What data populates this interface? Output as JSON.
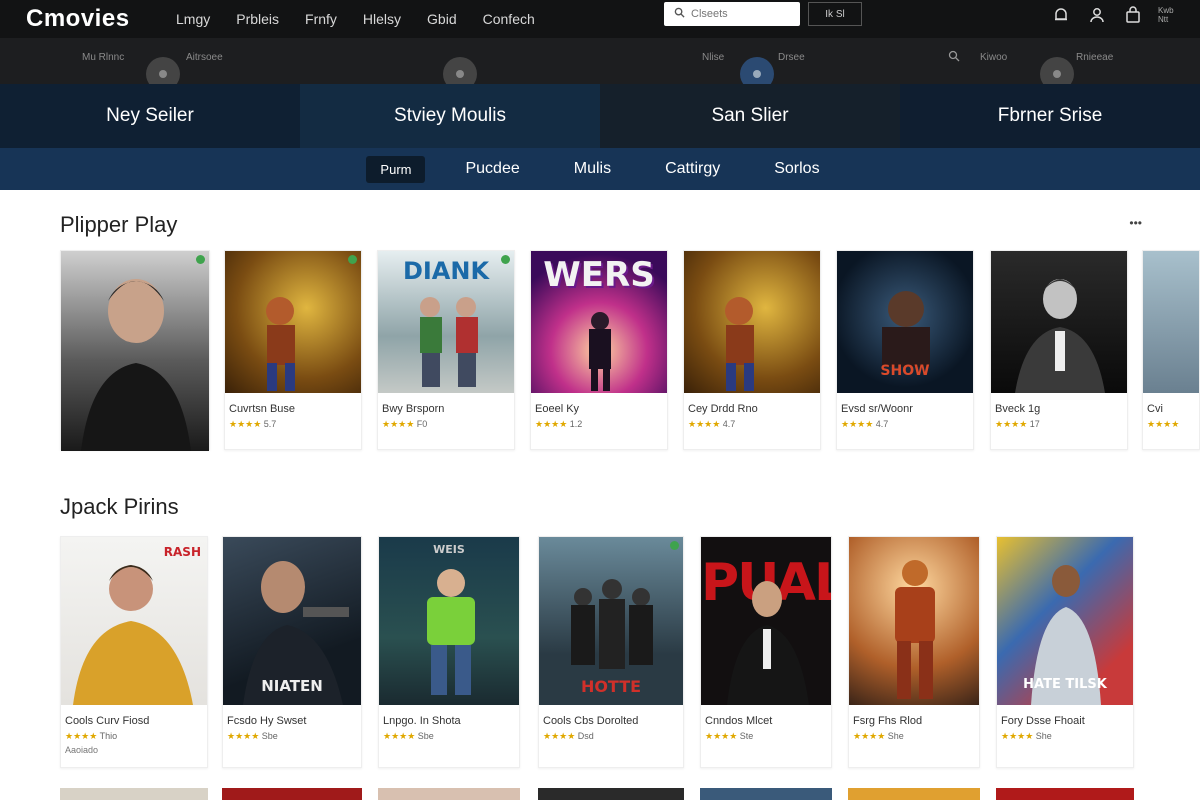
{
  "header": {
    "logo": "Cmovies",
    "nav": [
      "Lmgy",
      "Prbleis",
      "Frnfy",
      "Hlelsy",
      "Gbid",
      "Confech"
    ],
    "search_placeholder": "Clseets",
    "search_button": "Ik Sl",
    "icons": [
      "bell-icon",
      "user-icon",
      "bag-icon"
    ],
    "corner_text": "Kwb Ntt"
  },
  "subbar": {
    "items": [
      "Mu Rlnnc",
      "Aitrsoee",
      "Nlise",
      "Drsee",
      "Kiwoo",
      "Rnieeae"
    ]
  },
  "banners": [
    "Ney Seiler",
    "Stviey Moulis",
    "San Slier",
    "Fbrner Srise"
  ],
  "categories": [
    "Purm",
    "Pucdee",
    "Mulis",
    "Cattirgy",
    "Sorlos"
  ],
  "sections": [
    {
      "title": "Plipper Play",
      "more": "•••",
      "cards": [
        {
          "title": "",
          "stars": "",
          "rating": "",
          "poster_text": ""
        },
        {
          "title": "Cuvrtsn Buse",
          "stars": "★★★★",
          "rating": "5.7",
          "poster_text": ""
        },
        {
          "title": "Bwy Brsporn",
          "stars": "★★★★",
          "rating": "F0",
          "poster_text": "DIANK"
        },
        {
          "title": "Eoeel Ky",
          "stars": "★★★★",
          "rating": "1.2",
          "poster_text": "WERS"
        },
        {
          "title": "Cey Drdd Rno",
          "stars": "★★★★",
          "rating": "4.7",
          "poster_text": ""
        },
        {
          "title": "Evsd sr/Woonr",
          "stars": "★★★★",
          "rating": "4.7",
          "poster_text": "SHOW"
        },
        {
          "title": "Bveck 1g",
          "stars": "★★★★",
          "rating": "17",
          "poster_text": ""
        },
        {
          "title": "Cvi",
          "stars": "★★★★",
          "rating": "",
          "poster_text": ""
        }
      ]
    },
    {
      "title": "Jpack Pirins",
      "cards": [
        {
          "title": "Cools Curv Fiosd",
          "stars": "★★★★",
          "rating": "Thio",
          "sub": "Aaoiado",
          "poster_text": "RASH"
        },
        {
          "title": "Fcsdo Hy Swset",
          "stars": "★★★★",
          "rating": "Sbe",
          "sub": "",
          "poster_text": "NIATEN"
        },
        {
          "title": "Lnpgo. In Shota",
          "stars": "★★★★",
          "rating": "Sbe",
          "sub": "",
          "poster_text": "WEIS"
        },
        {
          "title": "Cools Cbs Dorolted",
          "stars": "★★★★",
          "rating": "Dsd",
          "sub": "",
          "poster_text": "HOTTE"
        },
        {
          "title": "Cnndos Mlcet",
          "stars": "★★★★",
          "rating": "Ste",
          "sub": "",
          "poster_text": "PUAL"
        },
        {
          "title": "Fsrg Fhs Rlod",
          "stars": "★★★★",
          "rating": "She",
          "sub": "",
          "poster_text": ""
        },
        {
          "title": "Fory Dsse Fhoait",
          "stars": "★★★★",
          "rating": "She",
          "sub": "",
          "poster_text": "HATE TILSK"
        }
      ]
    }
  ],
  "colors": {
    "topbar": "#121314",
    "banner_bg": "#0f2033",
    "category_bar": "#173456",
    "star": "#e0a800"
  }
}
